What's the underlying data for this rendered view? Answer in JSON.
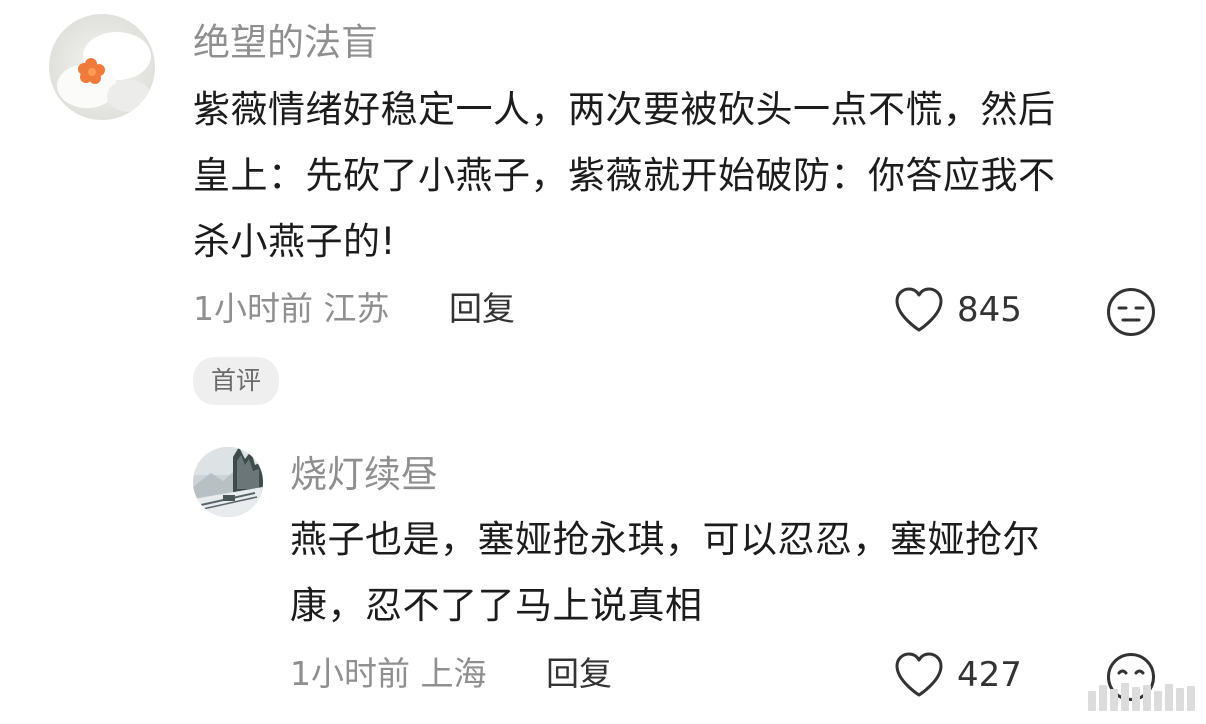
{
  "comment": {
    "username": "绝望的法盲",
    "content_lines": [
      "紫薇情绪好稳定一人，两次要被砍头一点不慌，然后",
      "皇上：先砍了小燕子，紫薇就开始破防：你答应我不",
      "杀小燕子的!"
    ],
    "meta": "1小时前 江苏",
    "reply_label": "回复",
    "like_count": "845",
    "badge": "首评"
  },
  "reply": {
    "username": "烧灯续昼",
    "content_lines": [
      "燕子也是，塞娅抢永琪，可以忍忍，塞娅抢尔",
      "康，忍不了了马上说真相"
    ],
    "meta": "1小时前 上海",
    "reply_label": "回复",
    "like_count": "427"
  },
  "icons": {
    "like": "heart-outline-icon",
    "emoji": "neutral-face-icon"
  },
  "colors": {
    "username": "#8f8f8f",
    "text": "#1c1c1c",
    "badge_bg": "#efefef"
  }
}
